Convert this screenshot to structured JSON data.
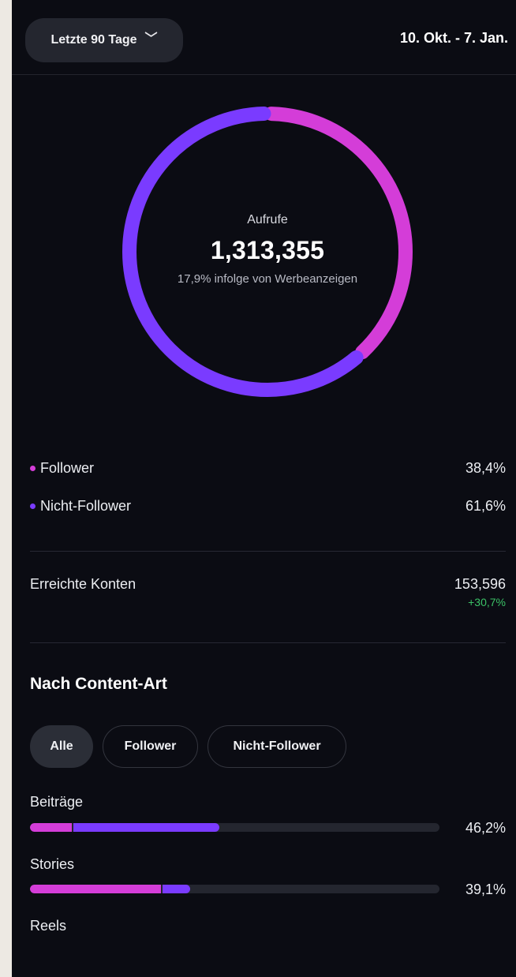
{
  "header": {
    "range_label": "Letzte 90 Tage",
    "date_range": "10. Okt. - 7. Jan."
  },
  "colors": {
    "follower": "#d43dd8",
    "non_follower": "#7a3bff",
    "track": "#24262f",
    "positive": "#3bc166"
  },
  "summary": {
    "label": "Aufrufe",
    "total": "1,313,355",
    "ads_note": "17,9% infolge von Werbeanzeigen",
    "follower_share": 38.4,
    "non_follower_share": 61.6
  },
  "legend": [
    {
      "label": "Follower",
      "value": "38,4%",
      "color": "#d43dd8"
    },
    {
      "label": "Nicht-Follower",
      "value": "61,6%",
      "color": "#7a3bff"
    }
  ],
  "reach": {
    "label": "Erreichte Konten",
    "value": "153,596",
    "change": "+30,7%"
  },
  "content_type": {
    "title": "Nach Content-Art",
    "filters": [
      "Alle",
      "Follower",
      "Nicht-Follower"
    ],
    "selected_filter": "Alle",
    "rows": [
      {
        "label": "Beiträge",
        "value": "46,2%",
        "share": 46.2,
        "follower_share": 10.2,
        "non_follower_share": 36.0
      },
      {
        "label": "Stories",
        "value": "39,1%",
        "share": 39.1,
        "follower_share": 32.0,
        "non_follower_share": 7.1
      },
      {
        "label": "Reels"
      }
    ]
  },
  "icons": {
    "dropdown": "chevron-down-icon"
  }
}
